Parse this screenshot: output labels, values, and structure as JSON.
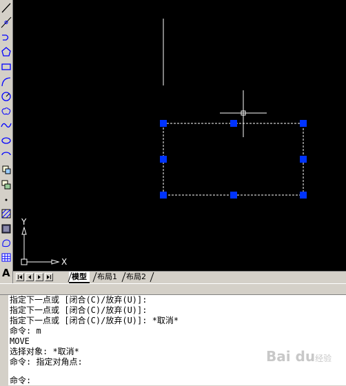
{
  "toolbar": {
    "tools": [
      "line-icon",
      "construction-line-icon",
      "polyline-icon",
      "polygon-icon",
      "rectangle-icon",
      "arc-icon",
      "circle-icon",
      "revision-cloud-icon",
      "spline-icon",
      "ellipse-icon",
      "ellipse-arc-icon",
      "insert-block-icon",
      "make-block-icon",
      "point-icon",
      "hatch-icon",
      "gradient-icon",
      "region-icon",
      "table-icon",
      "multiline-text-icon"
    ],
    "text_tool_glyph": "A"
  },
  "canvas": {
    "background": "#000000",
    "grip_color": "#0033ff",
    "ucs_icon": {
      "y_label": "Y",
      "x_label": "X"
    }
  },
  "tabs": {
    "items": [
      "模型",
      "布局1",
      "布局2"
    ],
    "active": "模型"
  },
  "command": {
    "lines": [
      "指定下一点或 [闭合(C)/放弃(U)]:",
      "指定下一点或 [闭合(C)/放弃(U)]:",
      "指定下一点或 [闭合(C)/放弃(U)]: *取消*",
      "命令: m",
      "MOVE",
      "选择对象: *取消*",
      "命令: 指定对角点:"
    ],
    "prompt": "命令:"
  },
  "watermark": {
    "text": "Bai du",
    "sub": "经验"
  }
}
